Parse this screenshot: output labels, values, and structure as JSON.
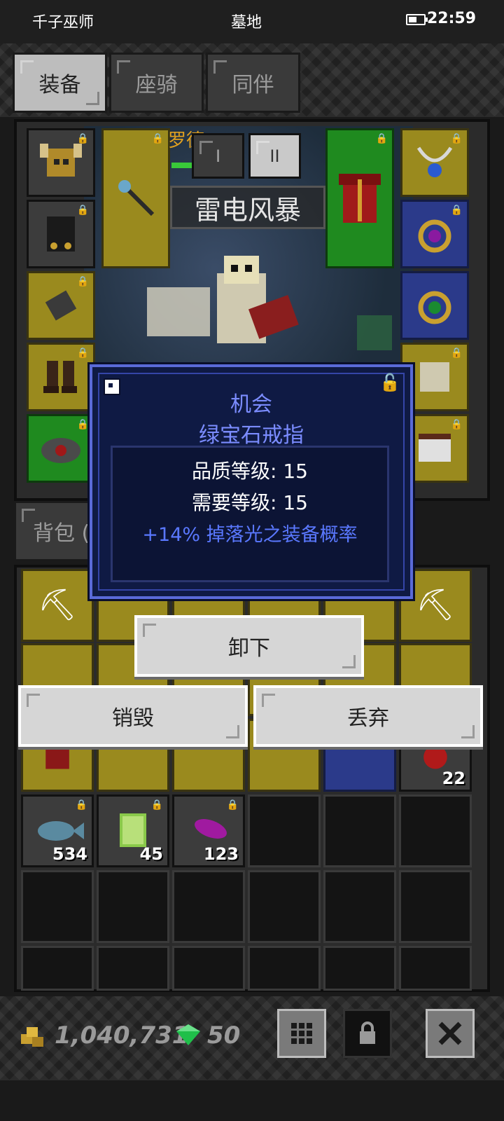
{
  "status_bar": {
    "app_name": "千子巫师",
    "location": "墓地",
    "time": "22:59"
  },
  "tabs": [
    {
      "label": "装备",
      "active": true
    },
    {
      "label": "座骑",
      "active": false
    },
    {
      "label": "同伴",
      "active": false
    }
  ],
  "equipment": {
    "skill_name": "雷电风暴",
    "toggle_buttons": [
      {
        "label": "I",
        "active": false
      },
      {
        "label": "II",
        "active": true
      }
    ]
  },
  "backpack_tab": {
    "label": "背包 ("
  },
  "tooltip": {
    "prefix": "机会",
    "item_name": "绿宝石戒指",
    "quality_level": "品质等级: 15",
    "required_level": "需要等级: 15",
    "bonus": "+14% 掉落光之装备概率"
  },
  "actions": {
    "unequip_label": "卸下",
    "destroy_label": "销毁",
    "discard_label": "丢弃"
  },
  "inventory": {
    "stack_counts": {
      "meat": "22",
      "fish": "534",
      "green_item": "45",
      "purple_item": "123"
    }
  },
  "currency": {
    "gold": "1,040,731",
    "gems": "50"
  },
  "colors": {
    "tooltip_bg": "#0f1a44",
    "tooltip_border": "#5a6ad8",
    "tooltip_title": "#7b8cff",
    "bonus_text": "#5a78ff",
    "slot_yellow": "#9a8a1e",
    "slot_blue": "#2b3a8a",
    "slot_green": "#1f8a1f"
  }
}
